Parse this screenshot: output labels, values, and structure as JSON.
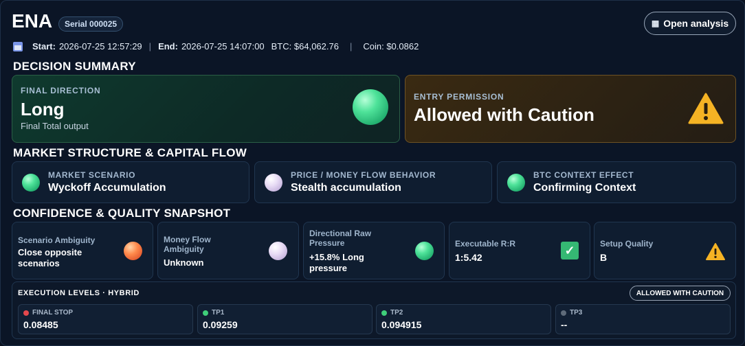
{
  "header": {
    "coin": "ENA",
    "serial": "Serial 000025",
    "open_analysis": "Open analysis",
    "start_label": "Start:",
    "start_value": "2026-07-25 12:57:29",
    "end_label": "End:",
    "end_value": "2026-07-25 14:07:00",
    "btc": "BTC: $64,062.76",
    "coin_price": "Coin: $0.0862"
  },
  "decision": {
    "section_title": "DECISION SUMMARY",
    "final_direction_label": "FINAL DIRECTION",
    "final_direction_value": "Long",
    "final_direction_sub": "Final Total output",
    "entry_permission_label": "ENTRY PERMISSION",
    "entry_permission_value": "Allowed with Caution"
  },
  "market": {
    "section_title": "MARKET STRUCTURE & CAPITAL FLOW",
    "cards": [
      {
        "label": "MARKET SCENARIO",
        "value": "Wyckoff Accumulation",
        "orb": "green"
      },
      {
        "label": "PRICE / MONEY FLOW BEHAVIOR",
        "value": "Stealth accumulation",
        "orb": "lilac"
      },
      {
        "label": "BTC CONTEXT EFFECT",
        "value": "Confirming Context",
        "orb": "green"
      }
    ]
  },
  "confidence": {
    "section_title": "CONFIDENCE & QUALITY SNAPSHOT",
    "cards": [
      {
        "label": "Scenario Ambiguity",
        "value": "Close opposite scenarios",
        "icon": "orange-orb-icon"
      },
      {
        "label": "Money Flow Ambiguity",
        "value": "Unknown",
        "icon": "lilac-orb-icon"
      },
      {
        "label": "Directional Raw Pressure",
        "value": "+15.8% Long pressure",
        "icon": "green-orb-icon"
      },
      {
        "label": "Executable R:R",
        "value": "1:5.42",
        "icon": "checkmark-icon"
      },
      {
        "label": "Setup Quality",
        "value": "B",
        "icon": "warning-icon"
      }
    ]
  },
  "execution": {
    "title": "EXECUTION LEVELS · HYBRID",
    "badge": "ALLOWED WITH CAUTION",
    "levels": [
      {
        "label": "FINAL STOP",
        "value": "0.08485",
        "color": "#e5484d"
      },
      {
        "label": "TP1",
        "value": "0.09259",
        "color": "#3fcf7a"
      },
      {
        "label": "TP2",
        "value": "0.094915",
        "color": "#3fcf7a"
      },
      {
        "label": "TP3",
        "value": "--",
        "color": "#5f6b7a"
      }
    ]
  },
  "colors": {
    "background": "#0b1526",
    "long_green": "#4fe39a",
    "caution_amber": "#f5b324",
    "stop_red": "#e5484d"
  }
}
